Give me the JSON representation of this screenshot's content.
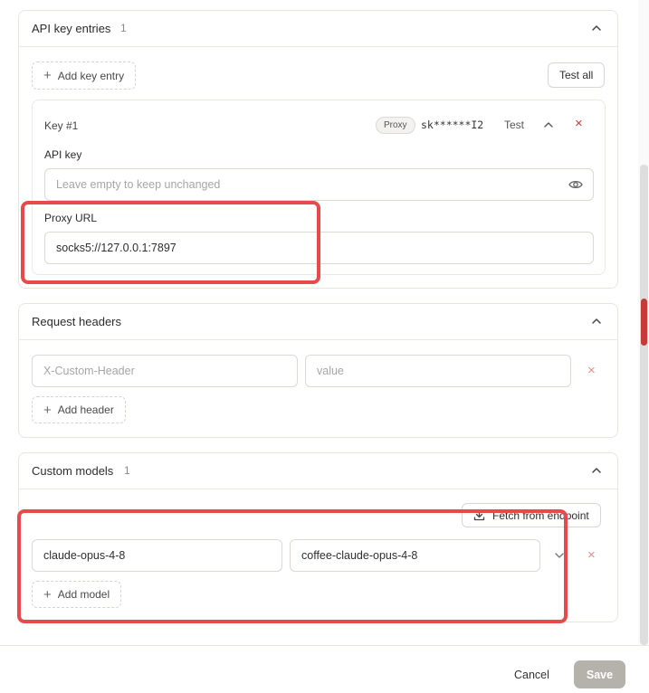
{
  "api_keys": {
    "title": "API key entries",
    "count": "1",
    "add_label": "Add key entry",
    "test_all_label": "Test all",
    "entry": {
      "title": "Key #1",
      "proxy_badge": "Proxy",
      "masked_key": "sk******I2",
      "test_label": "Test",
      "api_key_label": "API key",
      "api_key_placeholder": "Leave empty to keep unchanged",
      "proxy_label": "Proxy URL",
      "proxy_value": "socks5://127.0.0.1:7897"
    }
  },
  "headers": {
    "title": "Request headers",
    "name_placeholder": "X-Custom-Header",
    "value_placeholder": "value",
    "add_label": "Add header"
  },
  "models": {
    "title": "Custom models",
    "count": "1",
    "fetch_label": "Fetch from endpoint",
    "rows": [
      {
        "model": "claude-opus-4-8",
        "alias": "coffee-claude-opus-4-8"
      }
    ],
    "add_label": "Add model"
  },
  "footer": {
    "cancel_label": "Cancel",
    "save_label": "Save"
  },
  "colors": {
    "annotation_red": "#e8494b",
    "remove_red": "#d9534f",
    "save_disabled": "#b5b1ab",
    "scroll_marker": "#c63a3a"
  },
  "icons": {
    "chevron": "chevron-up-icon",
    "eye": "eye-icon",
    "remove": "close-icon",
    "download": "download-icon",
    "plus": "plus-icon"
  }
}
